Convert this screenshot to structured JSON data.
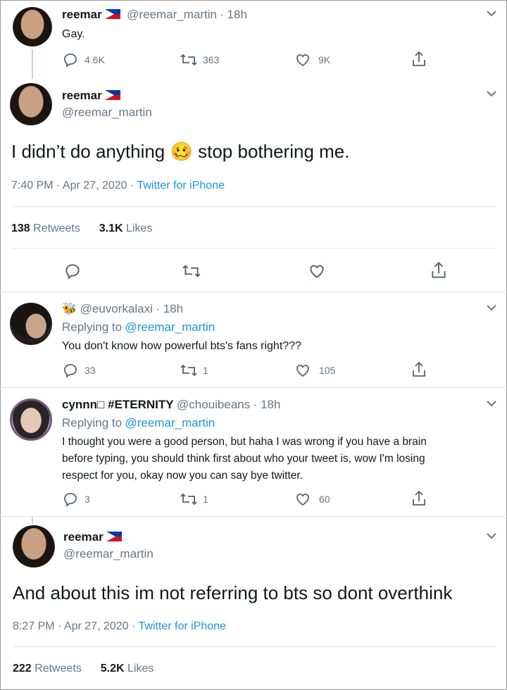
{
  "tweet1": {
    "name": "reemar",
    "handle": "@reemar_martin",
    "time": "18h",
    "text": "Gay.",
    "replies": "4.6K",
    "retweets": "363",
    "likes": "9K"
  },
  "tweet2": {
    "name": "reemar",
    "handle": "@reemar_martin",
    "text_part1": "I didn’t do anything",
    "emoji": "🥴",
    "text_part2": "stop bothering me.",
    "timestamp": "7:40 PM · Apr 27, 2020 ·",
    "source": "Twitter for iPhone",
    "retweets_count": "138",
    "retweets_label": "Retweets",
    "likes_count": "3.1K",
    "likes_label": "Likes"
  },
  "reply1": {
    "emoji": "🐝",
    "handle": "@euvorkalaxi",
    "time": "· 18h",
    "replying_label": "Replying to",
    "replying_to": "@reemar_martin",
    "text": "You don't know how powerful bts's fans right???",
    "replies": "33",
    "retweets": "1",
    "likes": "105"
  },
  "reply2": {
    "name": "cynnn□ #ETERNITY",
    "handle": "@chouibeans",
    "time": "· 18h",
    "replying_label": "Replying to",
    "replying_to": "@reemar_martin",
    "text_line1": "I thought you were a good person, but haha I was wrong if you have a brain",
    "text_line2": "before typing, you should think first about who your tweet is, wow I'm losing",
    "text_line3": "respect for you, okay now you can say bye twitter.",
    "replies": "3",
    "retweets": "1",
    "likes": "60"
  },
  "tweet3": {
    "name": "reemar",
    "handle": "@reemar_martin",
    "text": "And about this im not referring to bts so dont overthink",
    "timestamp": "8:27 PM · Apr 27, 2020 ·",
    "source": "Twitter for iPhone",
    "retweets_count": "222",
    "retweets_label": "Retweets",
    "likes_count": "5.2K",
    "likes_label": "Likes"
  },
  "colors": {
    "link": "#1b95e0",
    "secondary_text": "#657786",
    "divider": "#e1e8ed",
    "icon": "#536471"
  },
  "icons": [
    "reply-icon",
    "retweet-icon",
    "like-icon",
    "share-icon",
    "chevron-down-icon",
    "philippines-flag-icon",
    "bee-emoji-icon",
    "woozy-face-emoji-icon"
  ]
}
